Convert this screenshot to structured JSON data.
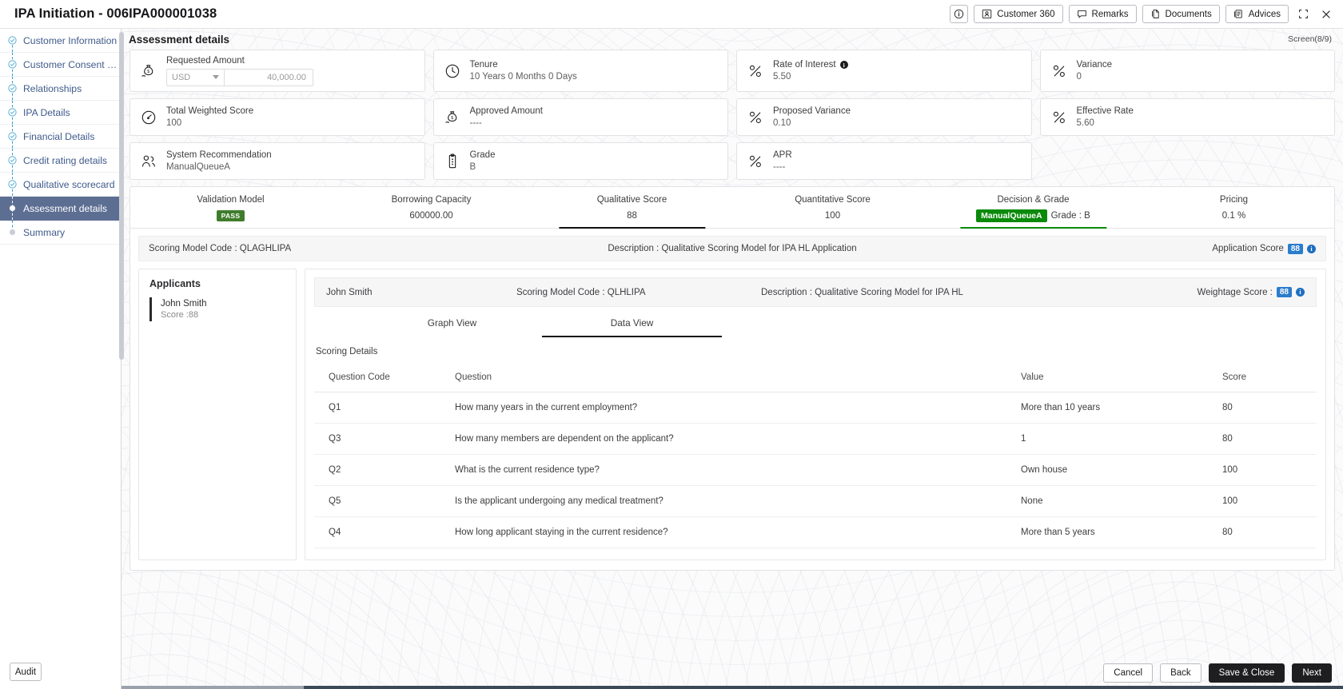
{
  "titlebar": {
    "app_title": "IPA Initiation - 006IPA000001038",
    "info_button": "",
    "buttons": [
      {
        "label": "Customer 360",
        "icon": "user-card-icon"
      },
      {
        "label": "Remarks",
        "icon": "comment-icon"
      },
      {
        "label": "Documents",
        "icon": "documents-icon"
      },
      {
        "label": "Advices",
        "icon": "advices-icon"
      }
    ],
    "minimize_label": "",
    "close_label": "✕"
  },
  "sidebar": {
    "items": [
      {
        "label": "Customer Information",
        "state": "done"
      },
      {
        "label": "Customer Consent and …",
        "state": "done"
      },
      {
        "label": "Relationships",
        "state": "done"
      },
      {
        "label": "IPA Details",
        "state": "done"
      },
      {
        "label": "Financial Details",
        "state": "done"
      },
      {
        "label": "Credit rating details",
        "state": "done"
      },
      {
        "label": "Qualitative scorecard",
        "state": "done"
      },
      {
        "label": "Assessment details",
        "state": "active"
      },
      {
        "label": "Summary",
        "state": "pending"
      }
    ],
    "audit_label": "Audit"
  },
  "page": {
    "title": "Assessment details",
    "screen_counter": "Screen(8/9)"
  },
  "cards": [
    {
      "label": "Requested Amount",
      "icon": "money-bag-icon",
      "type": "amount",
      "currency": "USD",
      "amount_placeholder": "40,000.00",
      "amount_value": ""
    },
    {
      "label": "Tenure",
      "icon": "clock-icon",
      "value": "10 Years 0 Months 0 Days"
    },
    {
      "label": "Rate of Interest",
      "icon": "percent-icon",
      "value": "5.50",
      "has_info": true
    },
    {
      "label": "Variance",
      "icon": "percent-icon",
      "value": "0"
    },
    {
      "label": "Total Weighted Score",
      "icon": "gauge-icon",
      "value": "100"
    },
    {
      "label": "Approved Amount",
      "icon": "money-bag-icon",
      "value": "----"
    },
    {
      "label": "Proposed Variance",
      "icon": "percent-icon",
      "value": "0.10"
    },
    {
      "label": "Effective Rate",
      "icon": "percent-icon",
      "value": "5.60"
    },
    {
      "label": "System Recommendation",
      "icon": "users-icon",
      "value": "ManualQueueA"
    },
    {
      "label": "Grade",
      "icon": "clipboard-icon",
      "value": "B"
    },
    {
      "label": "APR",
      "icon": "percent-icon",
      "value": "----"
    }
  ],
  "score_tabs": [
    {
      "label": "Validation Model",
      "value": "PASS",
      "kind": "badge-pass",
      "active": false
    },
    {
      "label": "Borrowing Capacity",
      "value": "600000.00",
      "kind": "text",
      "active": false
    },
    {
      "label": "Qualitative Score",
      "value": "88",
      "kind": "text",
      "active": true
    },
    {
      "label": "Quantitative Score",
      "value": "100",
      "kind": "text",
      "active": false
    },
    {
      "label": "Decision & Grade",
      "value": "ManualQueueA",
      "extra": "Grade : B",
      "kind": "badge-green",
      "active": false
    },
    {
      "label": "Pricing",
      "value": "0.1 %",
      "kind": "text",
      "active": false
    }
  ],
  "model_bar": {
    "scoring_model_code": "Scoring Model Code : QLAGHLIPA",
    "description": "Description : Qualitative Scoring Model for IPA HL Application",
    "application_score_label": "Application Score",
    "application_score_value": "88"
  },
  "applicants": {
    "title": "Applicants",
    "list": [
      {
        "name": "John Smith",
        "score": "Score :88"
      }
    ]
  },
  "detail_head": {
    "applicant": "John Smith",
    "scoring_model_code": "Scoring Model Code : QLHLIPA",
    "description": "Description : Qualitative Scoring Model for IPA HL",
    "weightage_label": "Weightage Score :",
    "weightage_value": "88"
  },
  "view_tabs": [
    {
      "label": "Graph View",
      "active": false
    },
    {
      "label": "Data View",
      "active": true
    }
  ],
  "scoring_details_label": "Scoring Details",
  "table": {
    "columns": [
      "Question Code",
      "Question",
      "Value",
      "Score"
    ],
    "rows": [
      {
        "code": "Q1",
        "question": "How many years in the current employment?",
        "value": "More than 10 years",
        "score": "80"
      },
      {
        "code": "Q3",
        "question": "How many members are dependent on the applicant?",
        "value": "1",
        "score": "80"
      },
      {
        "code": "Q2",
        "question": "What is the current residence type?",
        "value": "Own house",
        "score": "100"
      },
      {
        "code": "Q5",
        "question": "Is the applicant undergoing any medical treatment?",
        "value": "None",
        "score": "100"
      },
      {
        "code": "Q4",
        "question": "How long applicant staying in the current residence?",
        "value": "More than 5 years",
        "score": "80"
      }
    ]
  },
  "footer": {
    "cancel": "Cancel",
    "back": "Back",
    "save_close": "Save & Close",
    "next": "Next"
  },
  "colors": {
    "accent_blue": "#2a7ccd",
    "nav_link": "#3f5b8b",
    "active_nav_bg": "#5d6e93",
    "pass_green": "#3f7d2c",
    "decision_green": "#0a8a0a",
    "dark_button": "#1e1e20"
  }
}
